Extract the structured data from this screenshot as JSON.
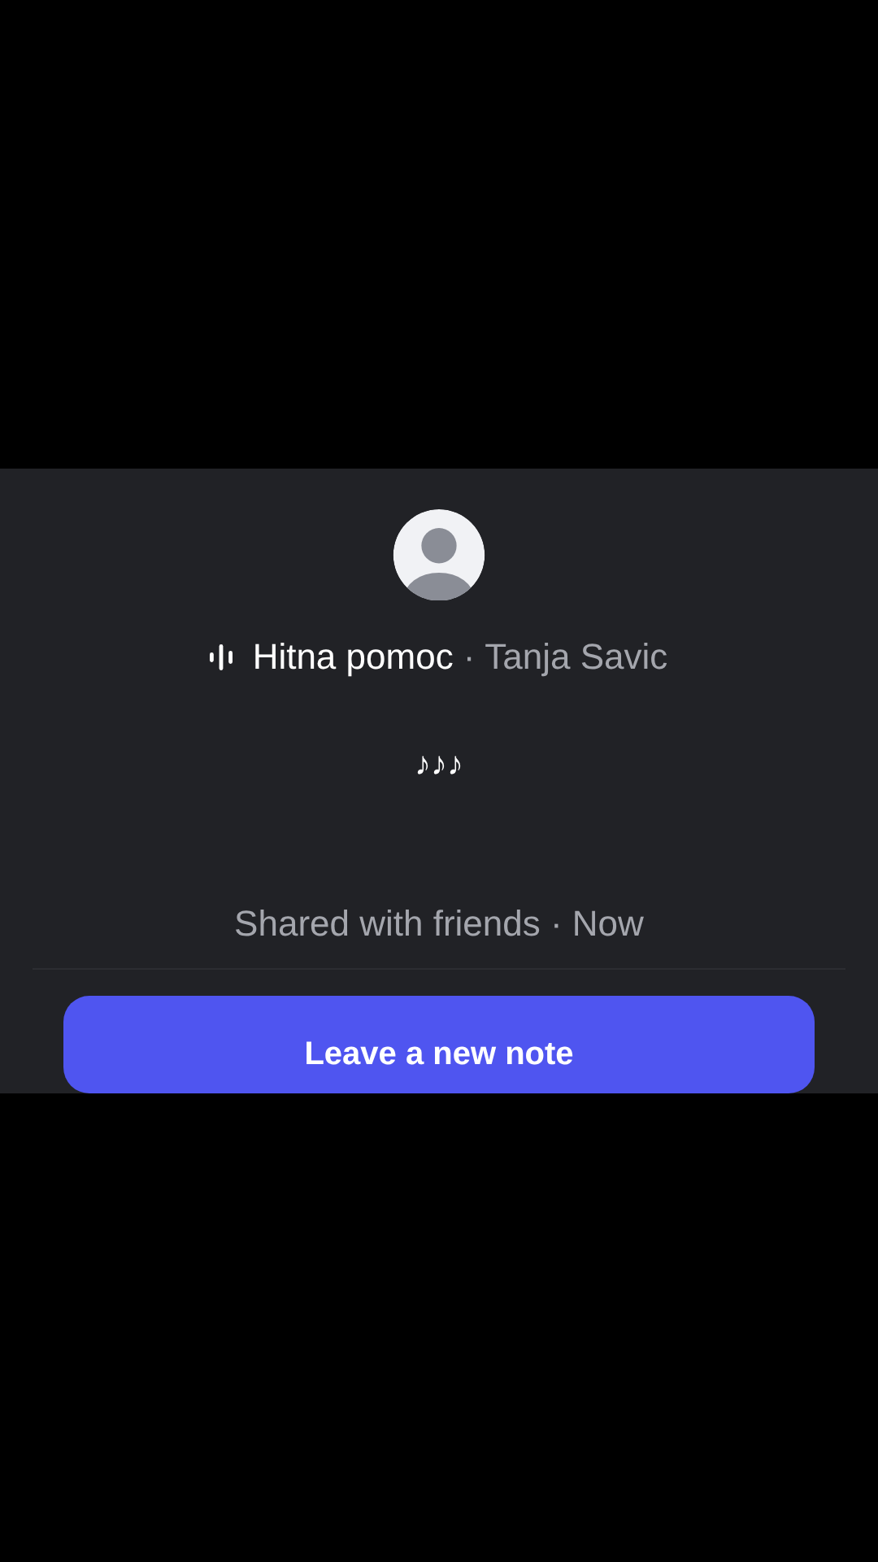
{
  "song": {
    "title": "Hitna pomoc",
    "separator": "·",
    "artist": "Tanja Savic"
  },
  "note": {
    "text": "♪♪♪",
    "footer": "Shared with friends · Now"
  },
  "button": {
    "label": "Leave a new note"
  }
}
